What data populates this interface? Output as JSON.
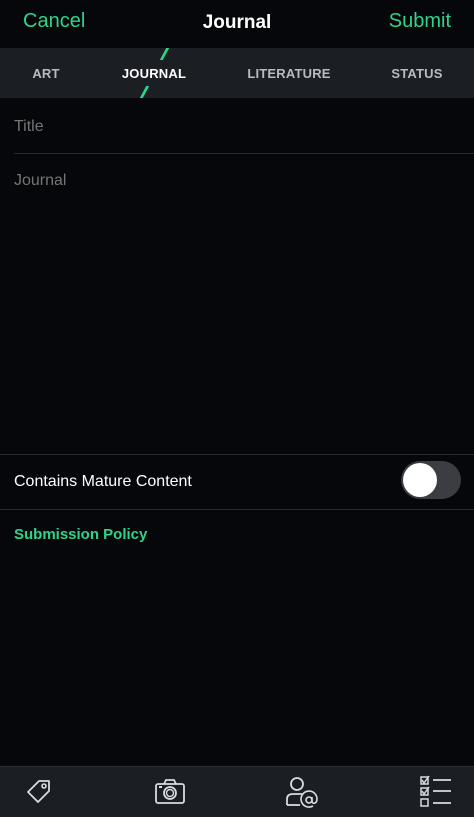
{
  "header": {
    "cancel_label": "Cancel",
    "title": "Journal",
    "submit_label": "Submit"
  },
  "tabs": [
    {
      "label": "ART",
      "active": false
    },
    {
      "label": "JOURNAL",
      "active": true
    },
    {
      "label": "LITERATURE",
      "active": false
    },
    {
      "label": "STATUS",
      "active": false
    }
  ],
  "form": {
    "title_placeholder": "Title",
    "title_value": "",
    "journal_placeholder": "Journal",
    "journal_value": "",
    "mature_label": "Contains Mature Content",
    "mature_enabled": false,
    "policy_link": "Submission Policy"
  },
  "toolbar": {
    "icons": [
      "tag-icon",
      "camera-icon",
      "mention-user-icon",
      "checklist-icon"
    ]
  },
  "colors": {
    "accent": "#2ed48a",
    "background": "#06070b",
    "bar": "#1b1f24"
  }
}
